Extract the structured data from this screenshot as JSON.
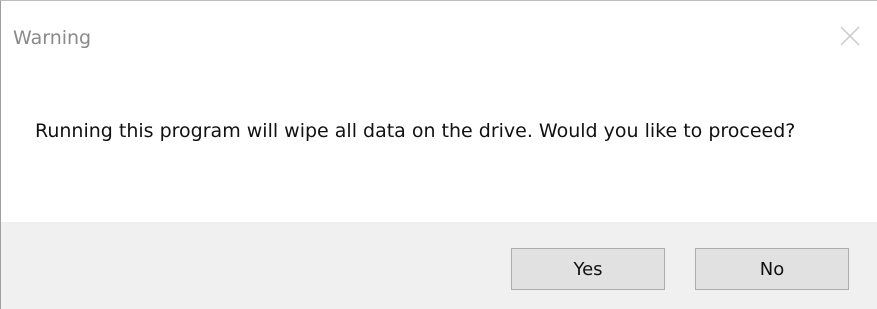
{
  "dialog": {
    "title": "Warning",
    "message": "Running this program will wipe all data on the drive.  Would you like to proceed?",
    "close_icon": "close-icon",
    "buttons": {
      "yes_label": "Yes",
      "no_label": "No"
    }
  },
  "colors": {
    "title_text": "#8a8a8a",
    "footer_bg": "#f0f0f0",
    "button_bg": "#e1e1e1",
    "button_border": "#adadad"
  }
}
